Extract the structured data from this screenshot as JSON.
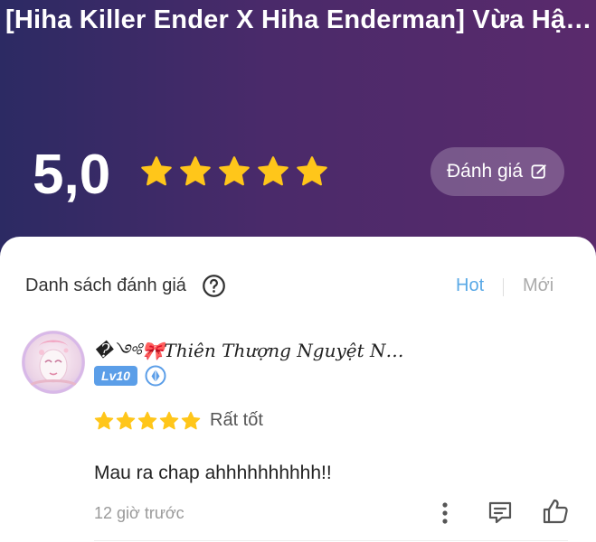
{
  "header": {
    "title": "[Hiha Killer Ender X Hiha Enderman] Vừa Hận Vừa Yêu",
    "score": "5,0",
    "star_count": 5,
    "rate_button_label": "Đánh giá"
  },
  "reviews_section": {
    "title": "Danh sách đánh giá",
    "sort_options": [
      "Hot",
      "Mới"
    ],
    "selected_sort": "Hot"
  },
  "review": {
    "username": "�༺🎀Thiên Thượng Nguyệt Nguyệt",
    "level": "Lv10",
    "stars": 5,
    "rating_label": "Rất tốt",
    "comment": "Mau ra chap ahhhhhhhhhh!!",
    "time": "12 giờ trước"
  },
  "colors": {
    "star": "#ffc61a",
    "accent": "#5aa9e6",
    "level_badge": "#5b9ee8"
  },
  "icons": [
    "star-icon",
    "edit-icon",
    "help-icon",
    "badge-icon",
    "more-icon",
    "reply-icon",
    "like-icon"
  ]
}
